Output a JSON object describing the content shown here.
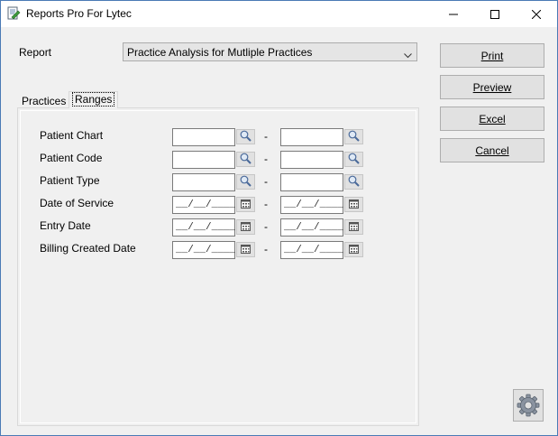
{
  "window": {
    "title": "Reports Pro For Lytec",
    "icon": "report-document-icon",
    "controls": [
      "minimize-icon",
      "maximize-icon",
      "close-icon"
    ]
  },
  "report": {
    "label": "Report",
    "selected": "Practice Analysis for Mutliple Practices"
  },
  "buttons": {
    "print": "Print",
    "preview": "Preview",
    "excel": "Excel",
    "cancel": "Cancel"
  },
  "tabs": [
    {
      "label": "Practices",
      "active": false
    },
    {
      "label": "Ranges",
      "active": true
    }
  ],
  "ranges": [
    {
      "label": "Patient Chart",
      "from": "",
      "to": "",
      "picker": "search-icon",
      "separator": "-"
    },
    {
      "label": "Patient Code",
      "from": "",
      "to": "",
      "picker": "search-icon",
      "separator": "-"
    },
    {
      "label": "Patient Type",
      "from": "",
      "to": "",
      "picker": "search-icon",
      "separator": "-"
    },
    {
      "label": "Date of Service",
      "from": "__/__/____",
      "to": "__/__/____",
      "picker": "calendar-icon",
      "separator": "-"
    },
    {
      "label": "Entry Date",
      "from": "__/__/____",
      "to": "__/__/____",
      "picker": "calendar-icon",
      "separator": "-"
    },
    {
      "label": "Billing Created Date",
      "from": "__/__/____",
      "to": "__/__/____",
      "picker": "calendar-icon",
      "separator": "-"
    }
  ],
  "settings_button": {
    "icon": "gear-icon"
  }
}
